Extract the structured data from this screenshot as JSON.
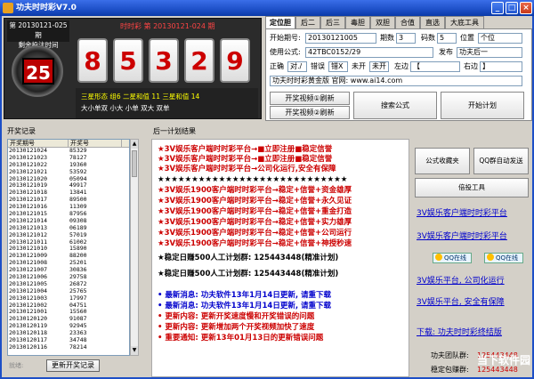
{
  "window": {
    "title": "功夫时时彩V7.0",
    "buttons": [
      "_",
      "□",
      "×"
    ]
  },
  "draw": {
    "period_line1": "第 20130121-025 期",
    "period_line2": "剩余投注时间",
    "countdown": "25",
    "header": "时时彩   第 20130121-024 期",
    "numbers": [
      "8",
      "5",
      "3",
      "2",
      "9"
    ],
    "stats_line1": "三星形态  组6  二星和值  11  三星和值  14",
    "stats_line2": "大小单双  小大  小单  双大  双单"
  },
  "tabs": [
    "定位胆",
    "后二",
    "后三",
    "毒胆",
    "双胆",
    "合值",
    "直选",
    "大底工具"
  ],
  "form": {
    "start_label": "开始期号:",
    "start_value": "20130121005",
    "periods_label": "期数",
    "periods_value": "3",
    "codes_label": "码数",
    "codes_value": "5",
    "position_label": "位置",
    "position_value": "个位",
    "formula_label": "使用公式:",
    "formula_value": "42TBC0152/29",
    "publish_label": "发布",
    "publish_value": "功夫后一",
    "right_label": "正确",
    "right_value": "对./",
    "wrong_label": "错误",
    "wrong_value": "错X",
    "unopened_label": "未开",
    "unopened_value": "未开",
    "left_border_label": "左边",
    "left_border_value": "【",
    "right_border_label": "右边",
    "right_border_value": "】",
    "footer_value": "功夫时时彩黄金版  官网: www.ai14.com",
    "btn_generate1": "开奖视频①刷新",
    "btn_generate2": "开奖视频②刷新",
    "btn_search": "搜索公式",
    "btn_start": "开始计划"
  },
  "records": {
    "header": "开奖记录",
    "col_period": "开奖期号",
    "col_number": "开奖号",
    "rows": [
      [
        "20130121024",
        "85329"
      ],
      [
        "20130121023",
        "78127"
      ],
      [
        "20130121022",
        "19360"
      ],
      [
        "20130121021",
        "53592"
      ],
      [
        "20130121020",
        "05094"
      ],
      [
        "20130121019",
        "49917"
      ],
      [
        "20130121018",
        "13841"
      ],
      [
        "20130121017",
        "89500"
      ],
      [
        "20130121016",
        "11309"
      ],
      [
        "20130121015",
        "87956"
      ],
      [
        "20130121014",
        "09308"
      ],
      [
        "20130121013",
        "06189"
      ],
      [
        "20130121012",
        "57019"
      ],
      [
        "20130121011",
        "61002"
      ],
      [
        "20130121010",
        "15890"
      ],
      [
        "20130121009",
        "88200"
      ],
      [
        "20130121008",
        "25201"
      ],
      [
        "20130121007",
        "30836"
      ],
      [
        "20130121006",
        "29758"
      ],
      [
        "20130121005",
        "26872"
      ],
      [
        "20130121004",
        "25765"
      ],
      [
        "20130121003",
        "17997"
      ],
      [
        "20130121002",
        "04751"
      ],
      [
        "20130121001",
        "15560"
      ],
      [
        "20130120120",
        "91087"
      ],
      [
        "20130120119",
        "92945"
      ],
      [
        "20130120118",
        "23363"
      ],
      [
        "20130120117",
        "34748"
      ],
      [
        "20130120116",
        "78214"
      ]
    ],
    "refresh_button": "更新开奖记录",
    "status": "就绪:"
  },
  "plan": {
    "header": "后一计划结果",
    "ads": [
      {
        "text": "★3V娱乐客户端时时彩平台→■立即注册■稳定信誉",
        "color": "#cc0000"
      },
      {
        "text": "★3V娱乐客户端时时彩平台→■立即注册■稳定信誉",
        "color": "#cc0000"
      },
      {
        "text": "★3V娱乐客户端时时彩平台→公司化运行,安全有保障",
        "color": "#cc0000"
      },
      {
        "text": "★★★★★★★★★★★★★★★★★★★★★★★★★★★★",
        "color": "#000000"
      },
      {
        "text": "★3V娱乐1900客户端时时彩平台→稳定+信誉+资金雄厚",
        "color": "#cc0000"
      },
      {
        "text": "★3V娱乐1900客户端时时彩平台→稳定+信誉+永久见证",
        "color": "#cc0000"
      },
      {
        "text": "★3V娱乐1900客户端时时彩平台→稳定+信誉+重金打造",
        "color": "#cc0000"
      },
      {
        "text": "★3V娱乐1900客户端时时彩平台→稳定+信誉+实力雄厚",
        "color": "#cc0000"
      },
      {
        "text": "★3V娱乐1900客户端时时彩平台→稳定+信誉+公司运行",
        "color": "#cc0000"
      },
      {
        "text": "★3V娱乐1900客户端时时彩平台→稳定+信誉+神授秒速",
        "color": "#cc0000"
      },
      {
        "text": "★稳定日赚500人工计划群: 125443448(精准计划)",
        "color": "#000000"
      },
      {
        "text": "★稳定日赚500人工计划群: 125443448(精准计划)",
        "color": "#000000"
      },
      {
        "text": "• 最新消息: 功夫软件13年1月14日更新, 请重下载",
        "color": "#0000cc"
      },
      {
        "text": "• 最新消息: 功夫软件13年1月14日更新, 请重下载",
        "color": "#0000cc"
      },
      {
        "text": "• 更新内容: 更新开奖速度慢和开奖错误的问题",
        "color": "#cc0000"
      },
      {
        "text": "• 更新内容: 更新增加两个开奖视频加快了速度",
        "color": "#cc0000"
      },
      {
        "text": "• 重要通知: 更新13年01月13日的更新错误问题",
        "color": "#cc0000"
      }
    ]
  },
  "side": {
    "btn_formula": "公式收藏夹",
    "btn_qq_auto": "QQ群自动发送",
    "btn_tools": "倍投工具",
    "link1": "3V娱乐客户端时时彩平台",
    "link2": "3V娱乐客户端时时彩平台",
    "qq1": "QQ在线",
    "qq2": "QQ在线",
    "link3": "3V娱乐平台, 公司化运行",
    "link4": "3V娱乐平台, 安全有保障",
    "download_link": "下载: 功夫时时彩终结版",
    "team_label": "功夫团队群:",
    "team_value": "125443448",
    "stable_label": "稳定包赚群:",
    "stable_value": "125443448"
  },
  "watermark": "当下软件园"
}
